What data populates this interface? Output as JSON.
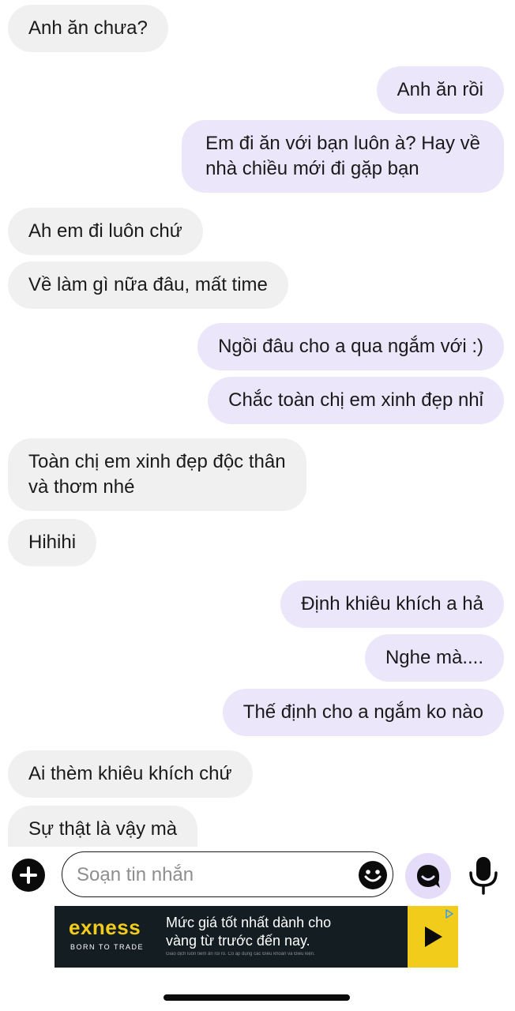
{
  "messages": [
    {
      "side": "in",
      "text": "Anh ăn chưa?"
    },
    {
      "side": "out",
      "text": "Anh ăn rồi"
    },
    {
      "side": "out",
      "text": "Em đi ăn với bạn luôn à? Hay về\nnhà chiều mới đi gặp bạn"
    },
    {
      "side": "in",
      "text": "Ah em đi luôn chứ"
    },
    {
      "side": "in",
      "text": "Về làm gì nữa đâu, mất time"
    },
    {
      "side": "out",
      "text": "Ngồi đâu cho a qua ngắm với :)"
    },
    {
      "side": "out",
      "text": "Chắc toàn chị em xinh đẹp nhỉ"
    },
    {
      "side": "in",
      "text": "Toàn chị em xinh đẹp độc thân\nvà thơm nhé"
    },
    {
      "side": "in",
      "text": "Hihihi"
    },
    {
      "side": "out",
      "text": "Định khiêu khích a hả"
    },
    {
      "side": "out",
      "text": "Nghe mà...."
    },
    {
      "side": "out",
      "text": "Thế định cho a ngắm ko nào"
    },
    {
      "side": "in",
      "text": "Ai thèm khiêu khích chứ"
    },
    {
      "side": "in",
      "text": "Sự thật là vậy mà"
    }
  ],
  "composer": {
    "placeholder": "Soạn tin nhắn",
    "value": "",
    "plus_icon": "plus-circle-icon",
    "emoji_icon": "smiley-icon",
    "sticker_icon": "sticker-icon",
    "mic_icon": "microphone-icon"
  },
  "ad": {
    "brand": "exness",
    "tagline": "BORN TO TRADE",
    "headline": "Mức giá tốt nhất dành cho\nvàng từ trước đến nay.",
    "fine_print": "Giao dịch luôn tiềm ẩn rủi ro. Có áp dụng các Điều khoản và Điều kiện.",
    "brand_color": "#f2cc1b",
    "background_color": "#141d22"
  },
  "colors": {
    "incoming_bubble": "#f0f0f0",
    "outgoing_bubble": "#ece6fa",
    "sticker_button": "#e5dcfa"
  }
}
